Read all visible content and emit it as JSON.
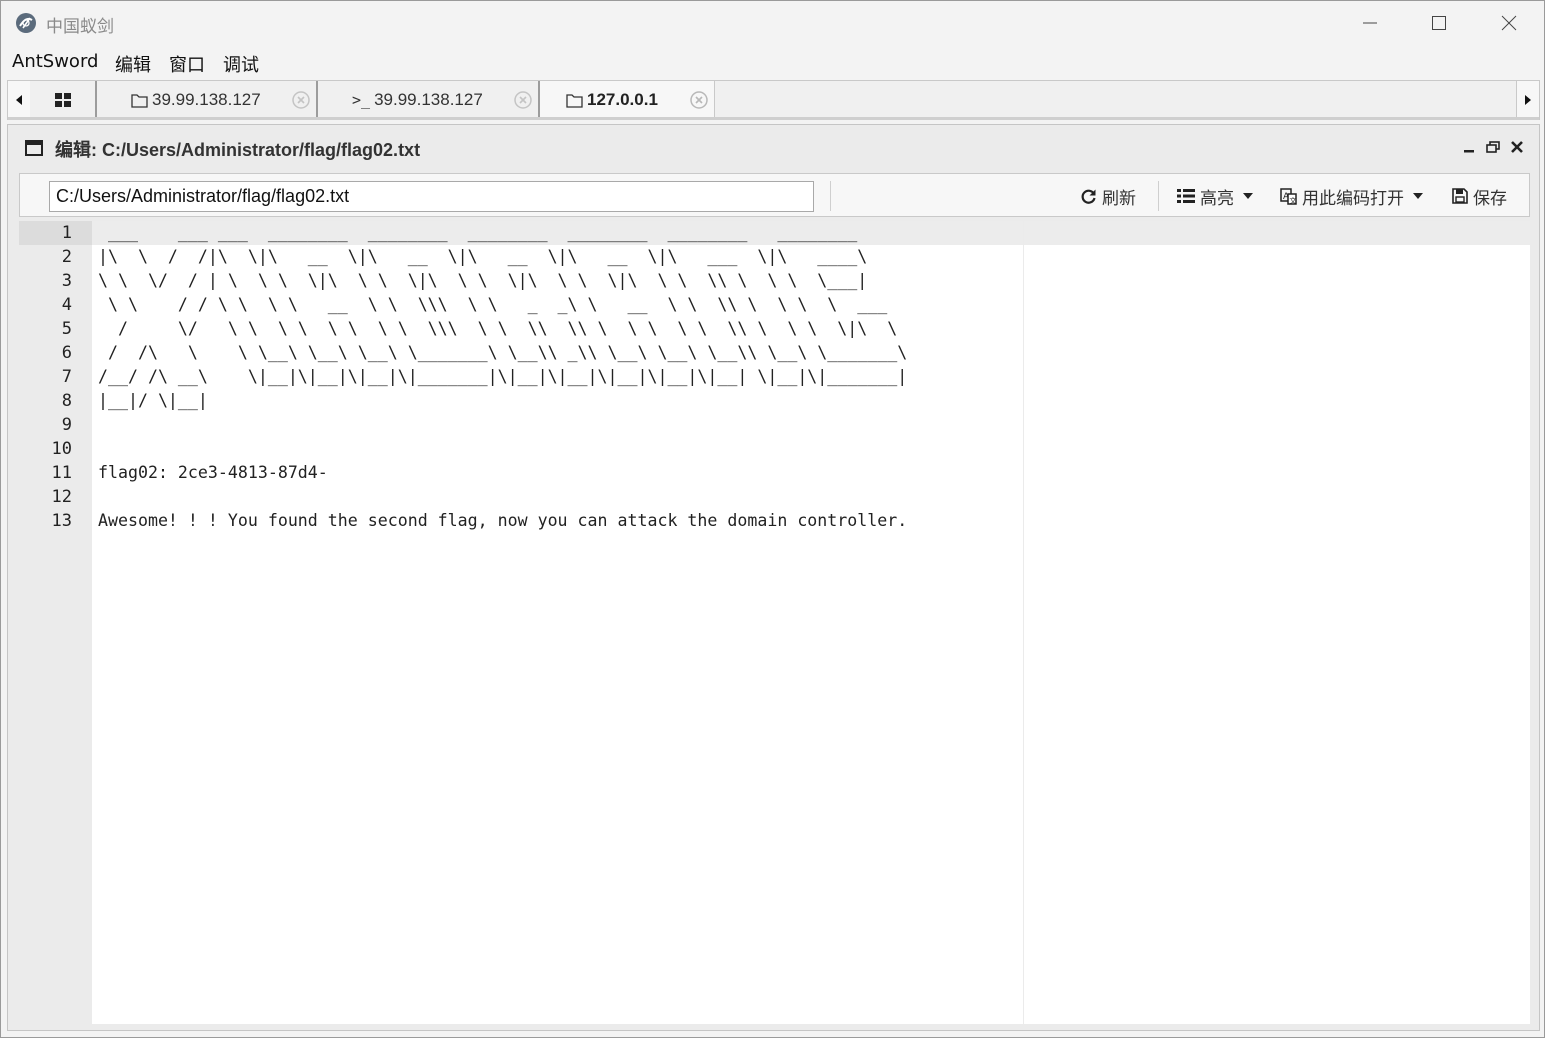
{
  "window": {
    "title": "中国蚁剑",
    "accent_color": "#1e88e5"
  },
  "menu": {
    "items": [
      "AntSword",
      "编辑",
      "窗口",
      "调试"
    ]
  },
  "tabs": [
    {
      "label": "",
      "icon": "grid-icon"
    },
    {
      "label": "39.99.138.127",
      "icon": "folder-icon"
    },
    {
      "label": "39.99.138.127",
      "icon": "terminal-icon"
    },
    {
      "label": "127.0.0.1",
      "icon": "folder-icon",
      "active": true
    }
  ],
  "panel": {
    "title": "编辑: C:/Users/Administrator/flag/flag02.txt"
  },
  "toolbar": {
    "path_value": "C:/Users/Administrator/flag/flag02.txt",
    "refresh_label": "刷新",
    "highlight_label": "高亮",
    "encoding_label": "用此编码打开",
    "save_label": "保存"
  },
  "editor": {
    "line_numbers": [
      "1",
      "2",
      "3",
      "4",
      "5",
      "6",
      "7",
      "8",
      "9",
      "10",
      "11",
      "12",
      "13"
    ],
    "lines": [
      " ___    ___ ___  ________  ________  ________  ________  ________   ________",
      "|\\  \\  /  /|\\  \\|\\   __  \\|\\   __  \\|\\   __  \\|\\   __  \\|\\   ___  \\|\\   ____\\",
      "\\ \\  \\/  / | \\  \\ \\  \\|\\  \\ \\  \\|\\  \\ \\  \\|\\  \\ \\  \\|\\  \\ \\  \\\\ \\  \\ \\  \\___|",
      " \\ \\    / / \\ \\  \\ \\   __  \\ \\  \\\\\\  \\ \\   _  _\\ \\   __  \\ \\  \\\\ \\  \\ \\  \\  ___",
      "  /     \\/   \\ \\  \\ \\  \\ \\  \\ \\  \\\\\\  \\ \\  \\\\  \\\\ \\  \\ \\  \\ \\  \\\\ \\  \\ \\  \\|\\  \\",
      " /  /\\   \\    \\ \\__\\ \\__\\ \\__\\ \\_______\\ \\__\\\\ _\\\\ \\__\\ \\__\\ \\__\\\\ \\__\\ \\_______\\",
      "/__/ /\\ __\\    \\|__|\\|__|\\|__|\\|_______|\\|__|\\|__|\\|__|\\|__|\\|__| \\|__|\\|_______|",
      "|__|/ \\|__|",
      "",
      "",
      "flag02: 2ce3-4813-87d4-",
      "",
      "Awesome! ! ! You found the second flag, now you can attack the domain controller."
    ]
  }
}
